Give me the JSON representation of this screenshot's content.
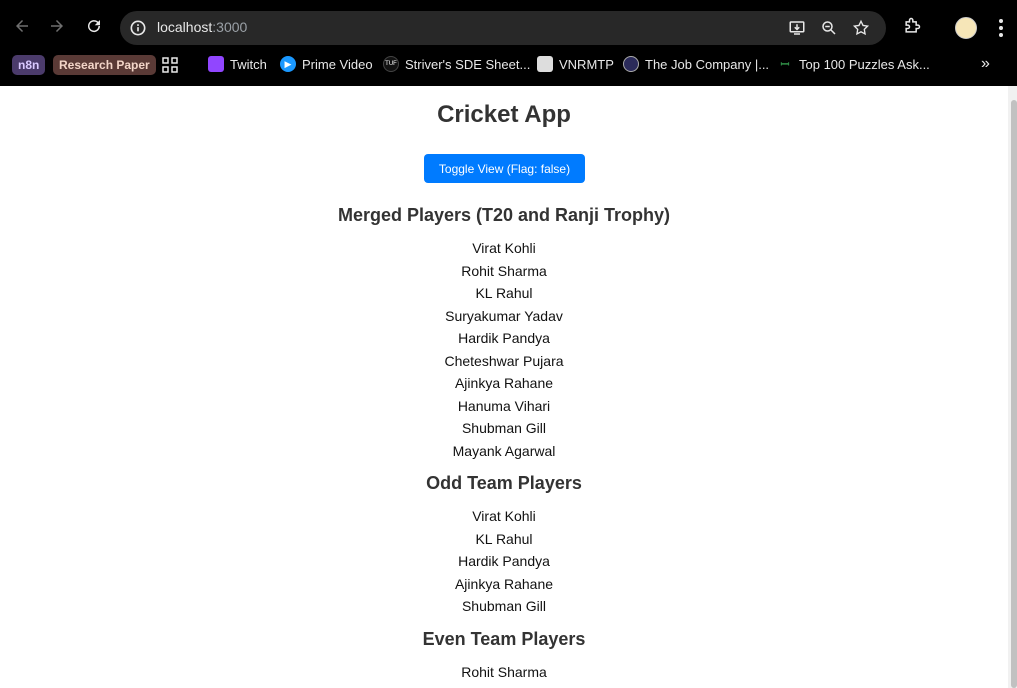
{
  "browser": {
    "url_host": "localhost",
    "url_port": ":3000",
    "bookmarks": [
      {
        "label": "n8n"
      },
      {
        "label": "Research Paper"
      },
      {
        "label": "Twitch"
      },
      {
        "label": "Prime Video"
      },
      {
        "label": "Striver's SDE Sheet..."
      },
      {
        "label": "VNRMTP"
      },
      {
        "label": "The Job Company |..."
      },
      {
        "label": "Top 100 Puzzles Ask..."
      }
    ],
    "more_bookmarks": "»"
  },
  "app": {
    "title": "Cricket App",
    "toggle_label": "Toggle View (Flag: false)",
    "merged_title": "Merged Players (T20 and Ranji Trophy)",
    "merged_players": [
      "Virat Kohli",
      "Rohit Sharma",
      "KL Rahul",
      "Suryakumar Yadav",
      "Hardik Pandya",
      "Cheteshwar Pujara",
      "Ajinkya Rahane",
      "Hanuma Vihari",
      "Shubman Gill",
      "Mayank Agarwal"
    ],
    "odd_title": "Odd Team Players",
    "odd_players": [
      "Virat Kohli",
      "KL Rahul",
      "Hardik Pandya",
      "Ajinkya Rahane",
      "Shubman Gill"
    ],
    "even_title": "Even Team Players",
    "even_players": [
      "Rohit Sharma"
    ]
  },
  "colors": {
    "accent": "#007bff",
    "chrome_bg": "#000000",
    "omnibox_bg": "#282828"
  }
}
